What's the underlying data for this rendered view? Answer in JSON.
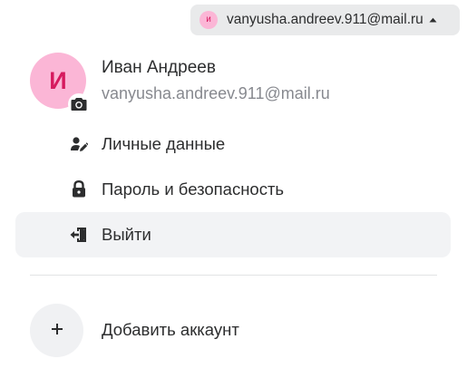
{
  "chip": {
    "avatar_letter": "и",
    "email": "vanyusha.andreev.911@mail.ru"
  },
  "profile": {
    "avatar_letter": "И",
    "name": "Иван Андреев",
    "email": "vanyusha.andreev.911@mail.ru"
  },
  "menu": {
    "items": [
      {
        "label": "Личные данные",
        "icon": "person-edit-icon"
      },
      {
        "label": "Пароль и безопасность",
        "icon": "lock-icon"
      },
      {
        "label": "Выйти",
        "icon": "logout-icon"
      }
    ]
  },
  "add_account": {
    "label": "Добавить аккаунт",
    "icon": "plus-icon"
  },
  "colors": {
    "avatar_bg": "#fbb6d6",
    "avatar_text": "#d61a5f",
    "chip_bg": "#e9eaeb",
    "hover_bg": "#f2f3f5",
    "secondary_text": "#87898f"
  }
}
